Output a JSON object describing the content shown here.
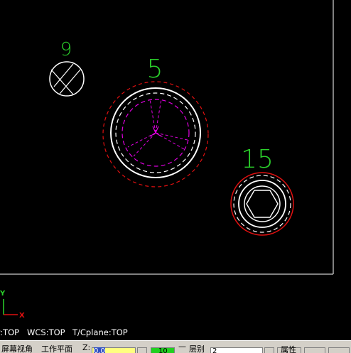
{
  "viewport": {
    "hole_labels": [
      "9",
      "5",
      "15"
    ],
    "axis_labels": {
      "y": "Y",
      "x": "X"
    }
  },
  "status": {
    "view": "v:TOP",
    "wcs": "WCS:TOP",
    "tcplane": "T/Cplane:TOP"
  },
  "toolbar": {
    "screen_view_label": "屏幕视角",
    "work_plane_label": "工作平面",
    "z_label": "Z:",
    "z_value": "0.0",
    "level_value": "10",
    "layer_label": "层别",
    "layer_value": "2",
    "properties_label": "属性"
  },
  "colors": {
    "background": "#000000",
    "label_green": "#2bd22b",
    "circle_white": "#ffffff",
    "circle_red": "#e01010",
    "tool_magenta": "#e000e0",
    "z_field_yellow": "#ffff80",
    "level_green": "#20d020"
  }
}
